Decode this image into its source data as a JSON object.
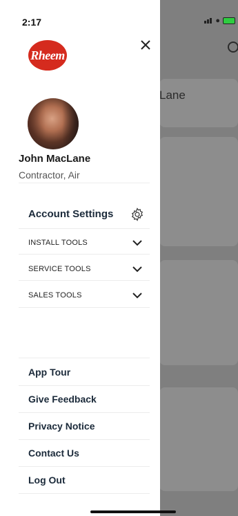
{
  "status": {
    "time": "2:17"
  },
  "brand": {
    "logo_text": "Rheem",
    "accent": "#d52b1e"
  },
  "background_app": {
    "partial_title": "Lane"
  },
  "profile": {
    "name": "John MacLane",
    "role": "Contractor, Air"
  },
  "menu": {
    "account_settings": "Account Settings",
    "sections": [
      {
        "label": "INSTALL TOOLS",
        "icon": "chevron-down-icon"
      },
      {
        "label": "SERVICE TOOLS",
        "icon": "chevron-down-icon"
      },
      {
        "label": "SALES TOOLS",
        "icon": "chevron-down-icon"
      }
    ],
    "links": [
      "App Tour",
      "Give Feedback",
      "Privacy Notice",
      "Contact Us",
      "Log Out"
    ]
  },
  "icons": {
    "close": "close-icon",
    "settings": "gear-icon",
    "search": "search-icon"
  }
}
